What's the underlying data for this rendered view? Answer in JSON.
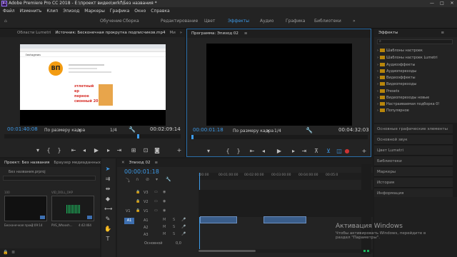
{
  "window": {
    "title": "Adobe Premiere Pro CC 2018 - E:\\проект видео\\wrkf\\Без названия *",
    "app_icon": "Pr",
    "controls": [
      "—",
      "□",
      "✕"
    ]
  },
  "menu": [
    "Файл",
    "Изменить",
    "Клип",
    "Эпизод",
    "Маркеры",
    "Графика",
    "Окно",
    "Справка"
  ],
  "workspaces": {
    "items": [
      "Обучение",
      "Сборка",
      "Редактирование",
      "Цвет",
      "Эффекты",
      "Аудио",
      "Графика",
      "Библиотеки"
    ],
    "active": "Эффекты",
    "more": "»"
  },
  "source_panel": {
    "tabs": [
      "Области Lumetri",
      "Источник: Бесконечная прокрутка подписчиков.mp4",
      "Ми"
    ],
    "tab_more": "»",
    "timecode": "00:01:40:08",
    "fit": "По размеру кадра",
    "scale": "1/4",
    "duration": "00:02:09:14",
    "preview": {
      "browser_tab": "Instagram",
      "caption_lines": [
        "зтлетный",
        "ер",
        "перное",
        "сионный 2017"
      ]
    }
  },
  "program_panel": {
    "tab": "Программа: Эпизод 02",
    "menu_icon": "≡",
    "timecode": "00:00:01:18",
    "fit": "По размеру кадра",
    "scale": "1/4",
    "duration": "00:04:32:03"
  },
  "effects_panel": {
    "tab": "Эффекты",
    "menu_icon": "≡",
    "items": [
      "Шаблоны настроек",
      "Шаблоны настроек Lumetri",
      "Аудиоэффекты",
      "Аудиопереходы",
      "Видеоэффекты",
      "Видеопереходы",
      "Presets",
      "Видеопереходы новые",
      "Настраиваемая подборка 0!",
      "Популярное"
    ]
  },
  "right_panels": [
    "Основные графические элементы",
    "Основной звук",
    "Цвет Lumetri",
    "Библиотеки",
    "Маркеры",
    "История",
    "Информация"
  ],
  "project_panel": {
    "tabs": [
      "Проект: Без названия",
      "Браузер медиаданных"
    ],
    "more": "»",
    "search_label": "Без названия.prproj",
    "thumbs": [
      {
        "name": "Бесконечная прокрутка...",
        "dur": "2:09:14"
      },
      {
        "name": "PVS_Whoosh...",
        "dur": "4:42:464"
      }
    ],
    "thumb_top_labels": [
      "100",
      "VID_DOLL_ОКР"
    ]
  },
  "timeline": {
    "tab": "Эпизод 02",
    "menu_icon": "≡",
    "timecode": "00:00:01:18",
    "ruler": [
      ":00:00",
      "00:01:00:00",
      "00:02:00:00",
      "00:03:00:00",
      "00:04:00:00",
      "00:05:0"
    ],
    "video_tracks": [
      "V3",
      "V2",
      "V1"
    ],
    "audio_tracks": [
      "A1",
      "A2",
      "A3"
    ],
    "source_patch": [
      "V1",
      "A1"
    ],
    "master": "Основной",
    "master_val": "0,0"
  },
  "watermark": {
    "title": "Активация Windows",
    "line1": "Чтобы активировать Windows, перейдите в",
    "line2": "раздел \"Параметры\"."
  }
}
